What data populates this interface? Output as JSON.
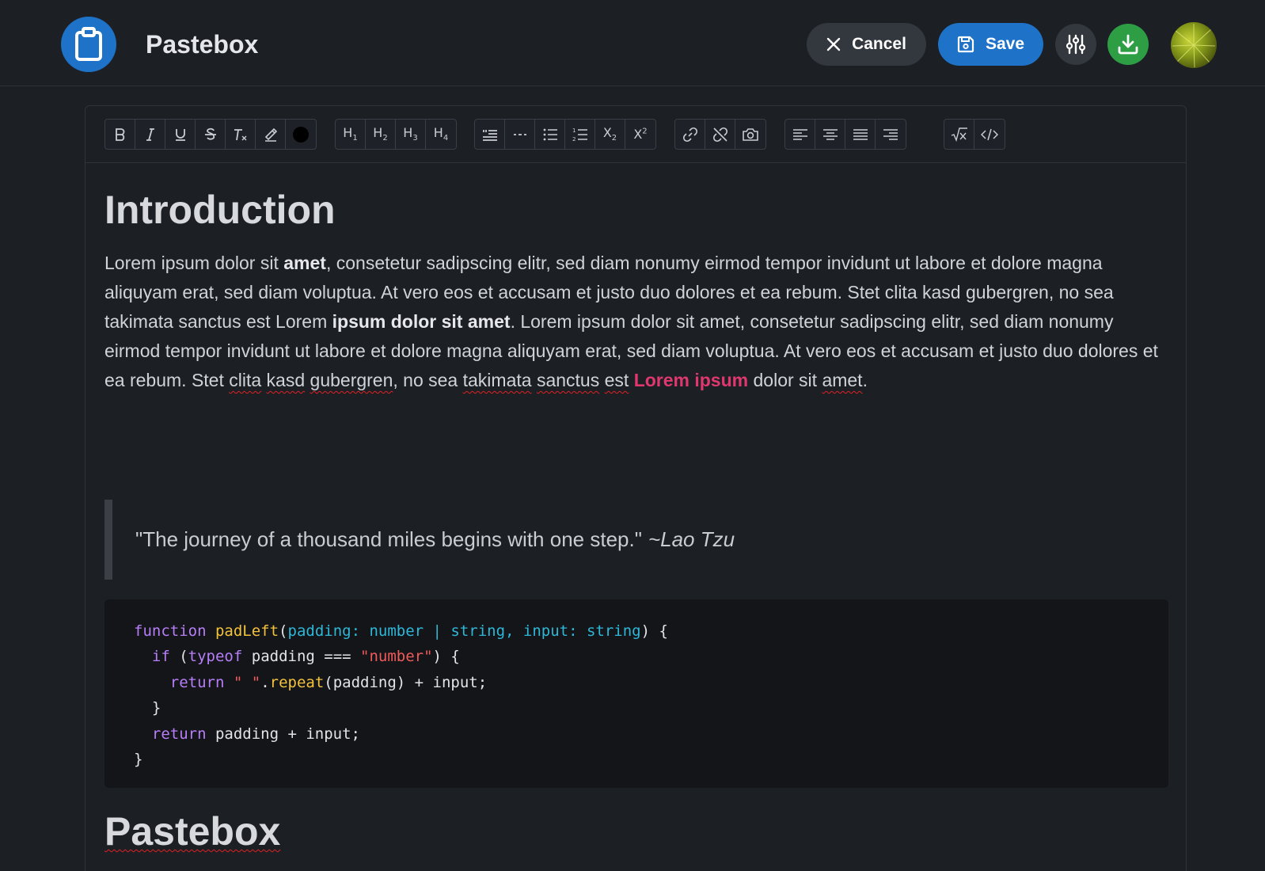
{
  "header": {
    "app_title": "Pastebox",
    "logo_icon": "clipboard-icon",
    "cancel_label": "Cancel",
    "save_label": "Save",
    "colors": {
      "accent": "#1e73c9",
      "download": "#2e9e45",
      "background": "#1c1f24"
    }
  },
  "toolbar": {
    "groups": [
      [
        "bold-icon",
        "italic-icon",
        "underline-icon",
        "strikethrough-icon",
        "clear-format-icon",
        "highlight-icon",
        "text-color-icon"
      ],
      [
        "heading-1-icon",
        "heading-2-icon",
        "heading-3-icon",
        "heading-4-icon"
      ],
      [
        "blockquote-icon",
        "horizontal-rule-icon",
        "bullet-list-icon",
        "ordered-list-icon",
        "subscript-icon",
        "superscript-icon"
      ],
      [
        "link-icon",
        "unlink-icon",
        "camera-icon"
      ],
      [
        "align-left-icon",
        "align-center-icon",
        "align-justify-icon",
        "align-right-icon"
      ],
      [
        "math-icon",
        "code-icon"
      ]
    ]
  },
  "document": {
    "heading1": "Introduction",
    "paragraph": {
      "p1": "Lorem ipsum dolor sit ",
      "b1": "amet",
      "p2": ", consetetur sadipscing elitr, sed diam nonumy eirmod tempor invidunt ut labore et dolore magna aliquyam erat, sed diam voluptua. At vero eos et accusam et justo duo dolores et ea rebum. Stet clita kasd gubergren, no sea takimata sanctus est Lorem ",
      "b2": "ipsum dolor sit amet",
      "p3": ". Lorem ipsum dolor sit amet, consetetur sadipscing elitr, sed diam nonumy eirmod tempor invidunt ut labore et dolore magna aliquyam erat, sed diam voluptua. At vero eos et accusam et justo duo dolores et ea rebum. Stet ",
      "s1": "clita",
      "s2": "kasd",
      "s3": "gubergren",
      "p4": ", no sea ",
      "s4": "takimata",
      "s5": "sanctus",
      "s6": "est",
      "pink": "Lorem ipsum",
      "p5": " dolor sit ",
      "s7": "amet",
      "p6": "."
    },
    "quote": {
      "text": "\"The journey of a thousand miles begins with one step.\"",
      "author": "~Lao Tzu"
    },
    "code": {
      "l1_kw": "function",
      "l1_fn": "padLeft",
      "l1_a": "(",
      "l1_p1": "padding: number | string, input: string",
      "l1_b": ") {",
      "l2_kw": "if",
      "l2_a": " (",
      "l2_kw2": "typeof",
      "l2_b": " padding === ",
      "l2_str": "\"number\"",
      "l2_c": ") {",
      "l3_kw": "return",
      "l3_str": "\" \"",
      "l3_a": ".",
      "l3_fn": "repeat",
      "l3_b": "(padding) + input;",
      "l4": "}",
      "l5_kw": "return",
      "l5_a": " padding + input;",
      "l6": "}"
    },
    "heading2": "Pastebox"
  },
  "mini_toolbar": [
    "math-icon",
    "code-icon"
  ]
}
